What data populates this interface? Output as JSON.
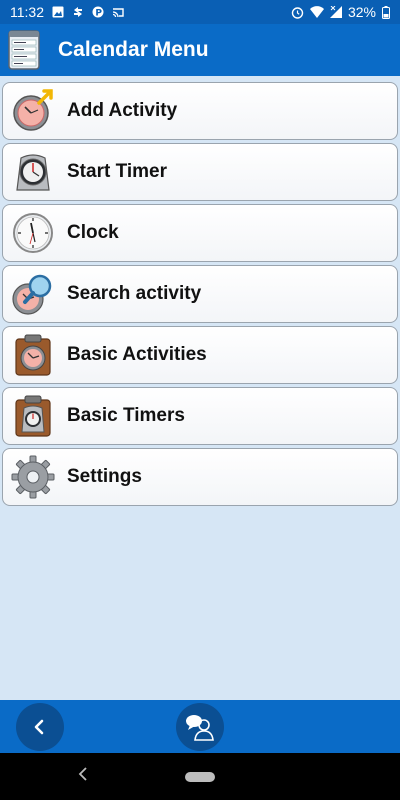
{
  "status_bar": {
    "time": "11:32",
    "battery": "32%",
    "left_icons": [
      "image-icon",
      "sync-icon",
      "parking-icon",
      "cast-icon"
    ],
    "right_icons": [
      "alarm-icon",
      "wifi-icon",
      "signal-icon",
      "battery-icon"
    ]
  },
  "header": {
    "title": "Calendar Menu",
    "logo_icon": "calendar-list-icon"
  },
  "menu": {
    "items": [
      {
        "label": "Add Activity",
        "icon": "add-activity-clock-icon"
      },
      {
        "label": "Start Timer",
        "icon": "timer-icon"
      },
      {
        "label": "Clock",
        "icon": "clock-icon"
      },
      {
        "label": "Search activity",
        "icon": "search-activity-icon"
      },
      {
        "label": "Basic Activities",
        "icon": "clipboard-clock-icon"
      },
      {
        "label": "Basic Timers",
        "icon": "clipboard-timer-icon"
      },
      {
        "label": "Settings",
        "icon": "gear-icon"
      }
    ]
  },
  "bottom_bar": {
    "back_icon": "chevron-left-icon",
    "user_icon": "chat-user-icon"
  },
  "colors": {
    "app_bar": "#0a6bc7",
    "background": "#d6e6f5"
  }
}
